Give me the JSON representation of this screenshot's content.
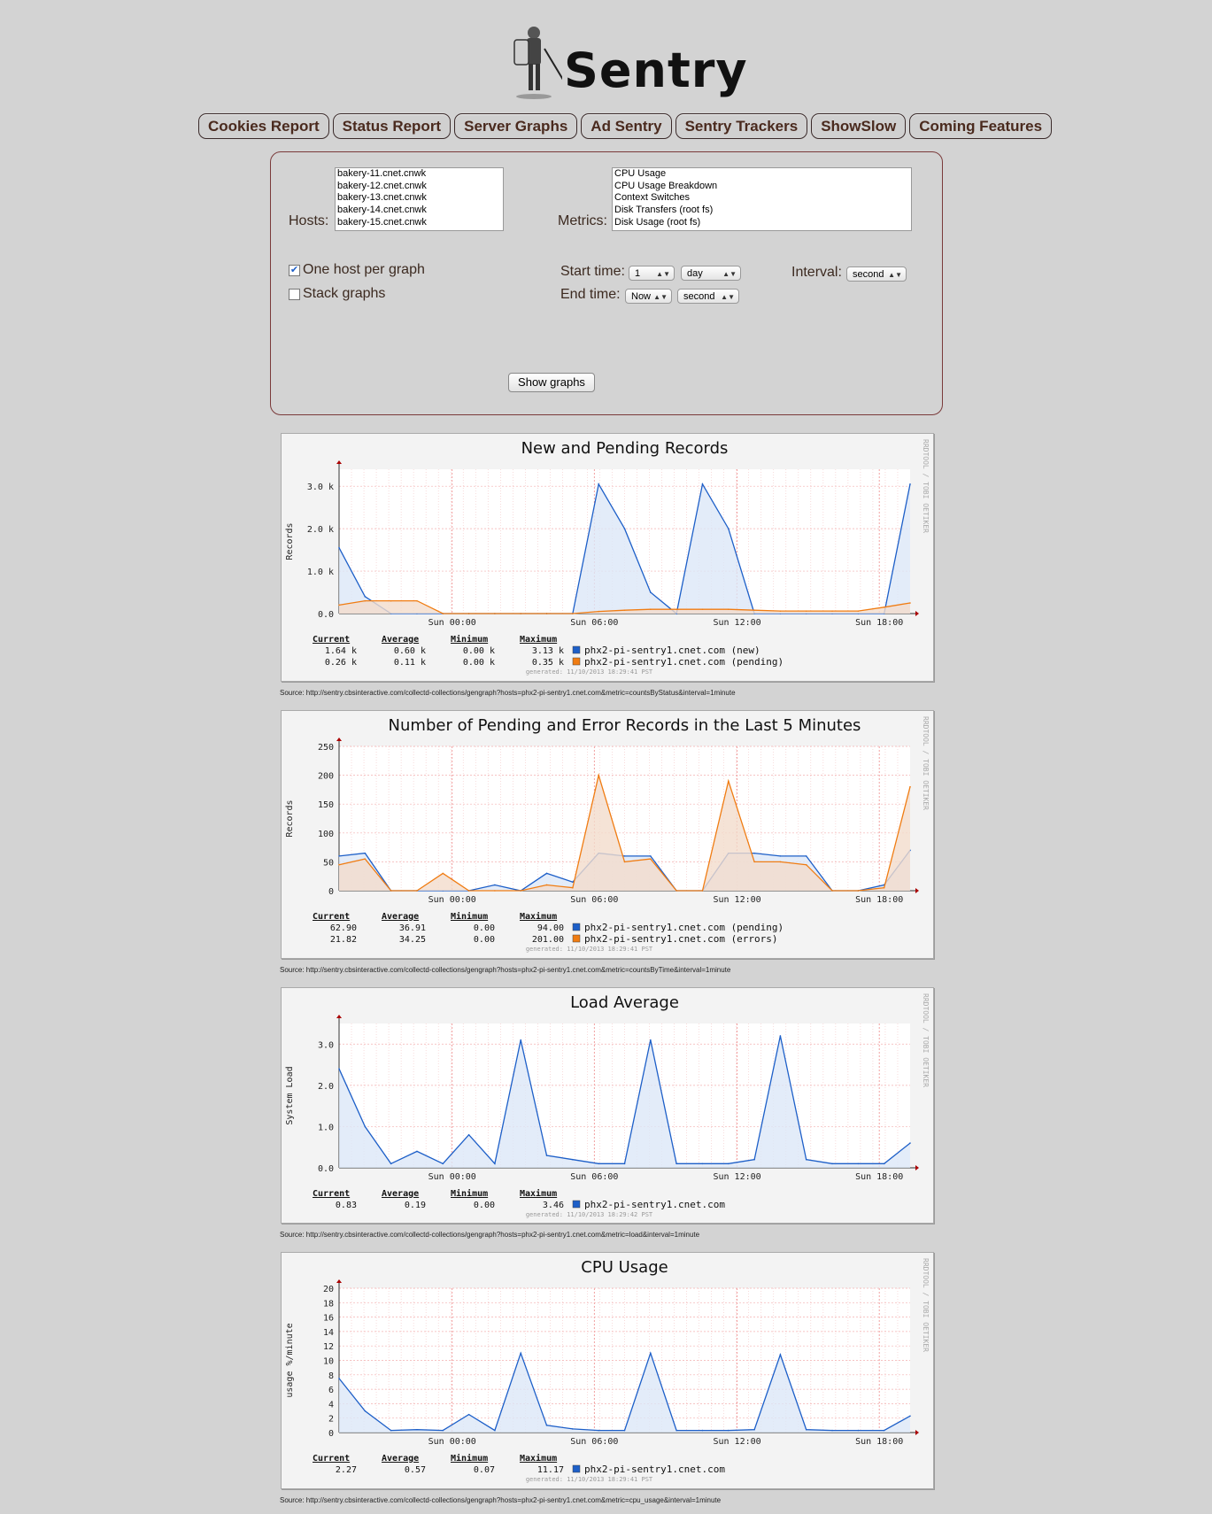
{
  "app": {
    "title": "Sentry"
  },
  "nav": [
    "Cookies Report",
    "Status Report",
    "Server Graphs",
    "Ad Sentry",
    "Sentry Trackers",
    "ShowSlow",
    "Coming Features"
  ],
  "form": {
    "hosts_label": "Hosts:",
    "hosts": [
      "bakery-11.cnet.cnwk",
      "bakery-12.cnet.cnwk",
      "bakery-13.cnet.cnwk",
      "bakery-14.cnet.cnwk",
      "bakery-15.cnet.cnwk"
    ],
    "metrics_label": "Metrics:",
    "metrics": [
      "CPU Usage",
      "CPU Usage Breakdown",
      "Context Switches",
      "Disk Transfers (root fs)",
      "Disk Usage (root fs)"
    ],
    "one_host_label": "One host per graph",
    "one_host_checked": true,
    "stack_label": "Stack graphs",
    "stack_checked": false,
    "start_label": "Start time:",
    "start_value": "1",
    "start_unit": "day",
    "end_label": "End time:",
    "end_value": "Now",
    "end_unit": "second",
    "interval_label": "Interval:",
    "interval_value": "second",
    "show_button": "Show graphs"
  },
  "colors": {
    "blue": "#1d5fc8",
    "orange": "#f07c12",
    "blue_fill": "#dce7f7",
    "orange_fill": "#f3dccc",
    "grid": "#f0a8a8"
  },
  "watermark": "RRDTOOL / TOBI OETIKER",
  "graphs": [
    {
      "title": "New and Pending Records",
      "ylabel": "Records",
      "yticks": [
        "3.0 k",
        "2.0 k",
        "1.0 k",
        "0.0"
      ],
      "xticks": [
        "Sun 00:00",
        "Sun 06:00",
        "Sun 12:00",
        "Sun 18:00"
      ],
      "headers": [
        "Current",
        "Average",
        "Minimum",
        "Maximum"
      ],
      "rows": [
        {
          "values": [
            "1.64 k",
            "0.60 k",
            "0.00 k",
            "3.13 k"
          ],
          "color": "#1d5fc8",
          "label": "phx2-pi-sentry1.cnet.com (new)"
        },
        {
          "values": [
            "0.26 k",
            "0.11 k",
            "0.00 k",
            "0.35 k"
          ],
          "color": "#f07c12",
          "label": "phx2-pi-sentry1.cnet.com (pending)"
        }
      ],
      "generated": "generated: 11/10/2013 18:29:41 PST",
      "source": "Source: http://sentry.cbsinteractive.com/collectd-collections/gengraph?hosts=phx2-pi-sentry1.cnet.com&metric=countsByStatus&interval=1minute"
    },
    {
      "title": "Number of Pending and Error Records in the Last 5 Minutes",
      "ylabel": "Records",
      "yticks": [
        "250",
        "200",
        "150",
        "100",
        "50",
        "0"
      ],
      "xticks": [
        "Sun 00:00",
        "Sun 06:00",
        "Sun 12:00",
        "Sun 18:00"
      ],
      "headers": [
        "Current",
        "Average",
        "Minimum",
        "Maximum"
      ],
      "rows": [
        {
          "values": [
            "62.90",
            "36.91",
            "0.00",
            "94.00"
          ],
          "color": "#1d5fc8",
          "label": "phx2-pi-sentry1.cnet.com (pending)"
        },
        {
          "values": [
            "21.82",
            "34.25",
            "0.00",
            "201.00"
          ],
          "color": "#f07c12",
          "label": "phx2-pi-sentry1.cnet.com (errors)"
        }
      ],
      "generated": "generated: 11/10/2013 18:29:41 PST",
      "source": "Source: http://sentry.cbsinteractive.com/collectd-collections/gengraph?hosts=phx2-pi-sentry1.cnet.com&metric=countsByTime&interval=1minute"
    },
    {
      "title": "Load Average",
      "ylabel": "System Load",
      "yticks": [
        "3.0",
        "2.0",
        "1.0",
        "0.0"
      ],
      "xticks": [
        "Sun 00:00",
        "Sun 06:00",
        "Sun 12:00",
        "Sun 18:00"
      ],
      "headers": [
        "Current",
        "Average",
        "Minimum",
        "Maximum"
      ],
      "rows": [
        {
          "values": [
            "0.83",
            "0.19",
            "0.00",
            "3.46"
          ],
          "color": "#1d5fc8",
          "label": "phx2-pi-sentry1.cnet.com"
        }
      ],
      "generated": "generated: 11/10/2013 18:29:42 PST",
      "source": "Source: http://sentry.cbsinteractive.com/collectd-collections/gengraph?hosts=phx2-pi-sentry1.cnet.com&metric=load&interval=1minute"
    },
    {
      "title": "CPU Usage",
      "ylabel": "usage %/minute",
      "yticks": [
        "20",
        "18",
        "16",
        "14",
        "12",
        "10",
        "8",
        "6",
        "4",
        "2",
        "0"
      ],
      "xticks": [
        "Sun 00:00",
        "Sun 06:00",
        "Sun 12:00",
        "Sun 18:00"
      ],
      "headers": [
        "Current",
        "Average",
        "Minimum",
        "Maximum"
      ],
      "rows": [
        {
          "values": [
            "2.27",
            "0.57",
            "0.07",
            "11.17"
          ],
          "color": "#1d5fc8",
          "label": "phx2-pi-sentry1.cnet.com"
        }
      ],
      "generated": "generated: 11/10/2013 18:29:41 PST",
      "source": "Source: http://sentry.cbsinteractive.com/collectd-collections/gengraph?hosts=phx2-pi-sentry1.cnet.com&metric=cpu_usage&interval=1minute"
    }
  ],
  "chart_data": [
    {
      "type": "area",
      "title": "New and Pending Records",
      "ylabel": "Records",
      "x": [
        "Sat 20:00",
        "Sat 21:00",
        "Sat 22:00",
        "Sat 23:00",
        "Sun 00:00",
        "Sun 01:00",
        "Sun 02:00",
        "Sun 03:00",
        "Sun 04:00",
        "Sun 05:00",
        "Sun 06:00",
        "Sun 07:00",
        "Sun 08:00",
        "Sun 09:00",
        "Sun 10:00",
        "Sun 11:00",
        "Sun 12:00",
        "Sun 13:00",
        "Sun 14:00",
        "Sun 15:00",
        "Sun 16:00",
        "Sun 17:00",
        "Sun 18:00"
      ],
      "ylim": [
        0,
        3400
      ],
      "series": [
        {
          "name": "phx2-pi-sentry1.cnet.com (new)",
          "values": [
            1550,
            400,
            0,
            0,
            0,
            0,
            0,
            0,
            0,
            0,
            3050,
            2000,
            500,
            0,
            3050,
            2000,
            0,
            0,
            0,
            0,
            0,
            0,
            3050
          ]
        },
        {
          "name": "phx2-pi-sentry1.cnet.com (pending)",
          "values": [
            200,
            300,
            300,
            300,
            0,
            0,
            0,
            0,
            0,
            0,
            50,
            80,
            100,
            100,
            100,
            100,
            80,
            60,
            60,
            60,
            60,
            150,
            250
          ]
        }
      ]
    },
    {
      "type": "area",
      "title": "Number of Pending and Error Records in the Last 5 Minutes",
      "ylabel": "Records",
      "x": [
        "Sat 20:00",
        "Sat 21:00",
        "Sat 22:00",
        "Sat 23:00",
        "Sun 00:00",
        "Sun 01:00",
        "Sun 02:00",
        "Sun 03:00",
        "Sun 04:00",
        "Sun 05:00",
        "Sun 06:00",
        "Sun 07:00",
        "Sun 08:00",
        "Sun 09:00",
        "Sun 10:00",
        "Sun 11:00",
        "Sun 12:00",
        "Sun 13:00",
        "Sun 14:00",
        "Sun 15:00",
        "Sun 16:00",
        "Sun 17:00",
        "Sun 18:00"
      ],
      "ylim": [
        0,
        250
      ],
      "series": [
        {
          "name": "phx2-pi-sentry1.cnet.com (pending)",
          "values": [
            60,
            65,
            0,
            0,
            0,
            0,
            10,
            0,
            30,
            15,
            65,
            60,
            60,
            0,
            0,
            65,
            65,
            60,
            60,
            0,
            0,
            10,
            70
          ]
        },
        {
          "name": "phx2-pi-sentry1.cnet.com (errors)",
          "values": [
            45,
            55,
            0,
            0,
            30,
            0,
            0,
            0,
            10,
            5,
            200,
            50,
            55,
            0,
            0,
            190,
            50,
            50,
            45,
            0,
            0,
            5,
            180
          ]
        }
      ]
    },
    {
      "type": "line",
      "title": "Load Average",
      "ylabel": "System Load",
      "x": [
        "Sat 20:00",
        "Sat 21:00",
        "Sat 22:00",
        "Sat 23:00",
        "Sun 00:00",
        "Sun 01:00",
        "Sun 02:00",
        "Sun 03:00",
        "Sun 04:00",
        "Sun 05:00",
        "Sun 06:00",
        "Sun 07:00",
        "Sun 08:00",
        "Sun 09:00",
        "Sun 10:00",
        "Sun 11:00",
        "Sun 12:00",
        "Sun 13:00",
        "Sun 14:00",
        "Sun 15:00",
        "Sun 16:00",
        "Sun 17:00",
        "Sun 18:00"
      ],
      "ylim": [
        0,
        3.5
      ],
      "series": [
        {
          "name": "phx2-pi-sentry1.cnet.com",
          "values": [
            2.4,
            1.0,
            0.1,
            0.4,
            0.1,
            0.8,
            0.1,
            3.1,
            0.3,
            0.2,
            0.1,
            0.1,
            3.1,
            0.1,
            0.1,
            0.1,
            0.2,
            3.2,
            0.2,
            0.1,
            0.1,
            0.1,
            0.6
          ]
        }
      ]
    },
    {
      "type": "line",
      "title": "CPU Usage",
      "ylabel": "usage %/minute",
      "x": [
        "Sat 20:00",
        "Sat 21:00",
        "Sat 22:00",
        "Sat 23:00",
        "Sun 00:00",
        "Sun 01:00",
        "Sun 02:00",
        "Sun 03:00",
        "Sun 04:00",
        "Sun 05:00",
        "Sun 06:00",
        "Sun 07:00",
        "Sun 08:00",
        "Sun 09:00",
        "Sun 10:00",
        "Sun 11:00",
        "Sun 12:00",
        "Sun 13:00",
        "Sun 14:00",
        "Sun 15:00",
        "Sun 16:00",
        "Sun 17:00",
        "Sun 18:00"
      ],
      "ylim": [
        0,
        20
      ],
      "series": [
        {
          "name": "phx2-pi-sentry1.cnet.com",
          "values": [
            7.5,
            3.0,
            0.3,
            0.4,
            0.3,
            2.5,
            0.3,
            11.0,
            1.0,
            0.5,
            0.3,
            0.3,
            11.0,
            0.3,
            0.3,
            0.3,
            0.4,
            10.8,
            0.4,
            0.3,
            0.3,
            0.3,
            2.3
          ]
        }
      ]
    }
  ]
}
